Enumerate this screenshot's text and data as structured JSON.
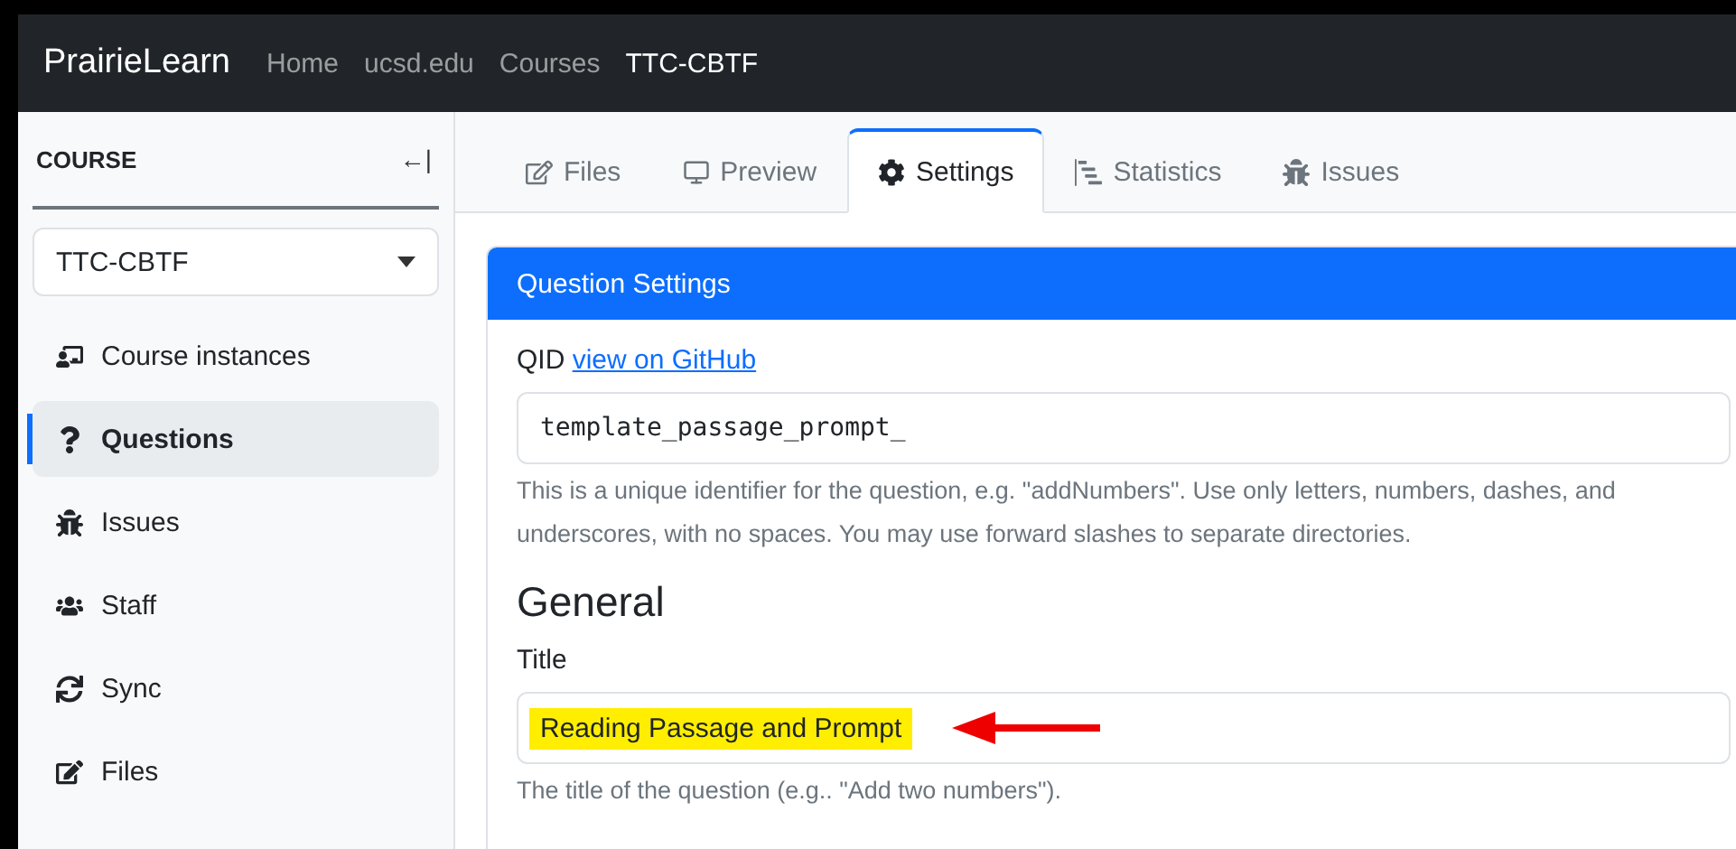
{
  "navbar": {
    "brand": "PrairieLearn",
    "breadcrumbs": [
      {
        "label": "Home",
        "selected": false
      },
      {
        "label": "ucsd.edu",
        "selected": false
      },
      {
        "label": "Courses",
        "selected": false
      },
      {
        "label": "TTC-CBTF",
        "selected": true
      }
    ]
  },
  "sidebar": {
    "heading": "COURSE",
    "collapse_glyph": "←|",
    "course_select": "TTC-CBTF",
    "items": [
      {
        "label": "Course instances",
        "kind": "instances",
        "selected": false
      },
      {
        "label": "Questions",
        "kind": "question",
        "selected": true
      },
      {
        "label": "Issues",
        "kind": "bug",
        "selected": false
      },
      {
        "label": "Staff",
        "kind": "users",
        "selected": false
      },
      {
        "label": "Sync",
        "kind": "sync",
        "selected": false
      },
      {
        "label": "Files",
        "kind": "edit",
        "selected": false
      }
    ]
  },
  "tabs": [
    {
      "label": "Files",
      "kind": "edit",
      "selected": false
    },
    {
      "label": "Preview",
      "kind": "monitor",
      "selected": false
    },
    {
      "label": "Settings",
      "kind": "gear",
      "selected": true
    },
    {
      "label": "Statistics",
      "kind": "chart",
      "selected": false
    },
    {
      "label": "Issues",
      "kind": "bug",
      "selected": false
    }
  ],
  "card": {
    "header": "Question Settings",
    "qid_label": "QID",
    "qid_link": "view on GitHub",
    "qid_value": "template_passage_prompt_",
    "qid_help": "This is a unique identifier for the question, e.g. \"addNumbers\". Use only letters, numbers, dashes, and underscores, with no spaces. You may use forward slashes to separate directories.",
    "section": "General",
    "title_label": "Title",
    "title_value": "Reading Passage and Prompt",
    "title_highlighted": true,
    "title_help": "The title of the question (e.g.. \"Add two numbers\")."
  }
}
